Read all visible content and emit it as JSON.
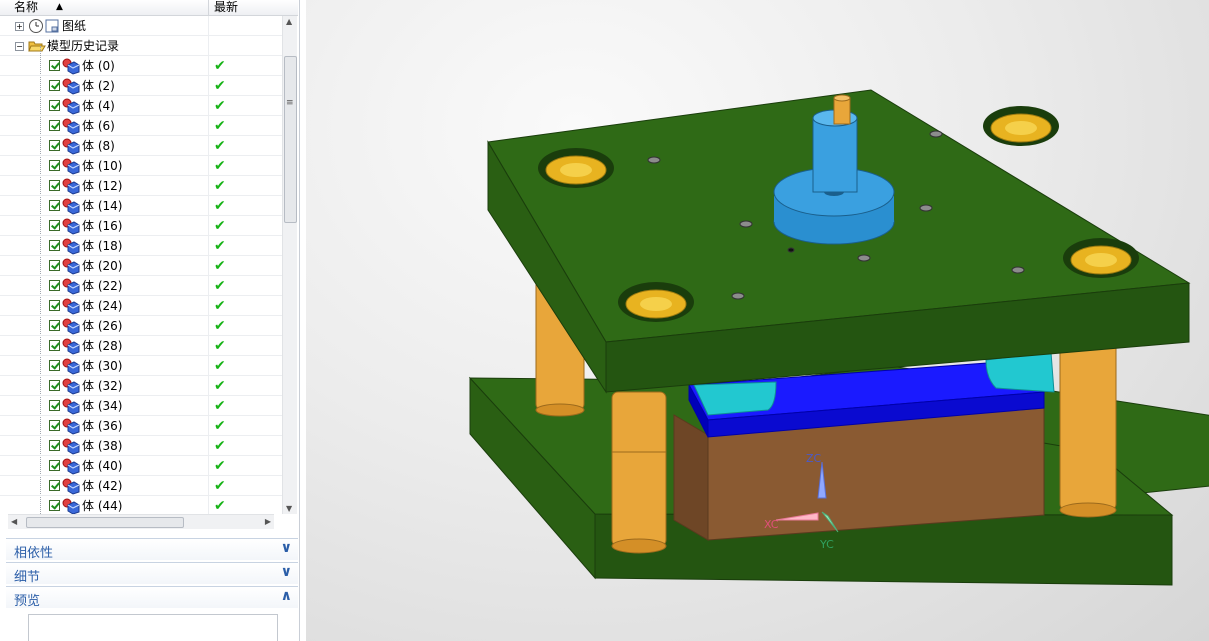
{
  "navigator": {
    "columns": {
      "name": "名称",
      "latest": "最新"
    },
    "tree": {
      "drawings": {
        "label": "图纸",
        "icon": "drawing-sheet-icon"
      },
      "model_history": {
        "label": "模型历史记录",
        "icon": "folder-open-icon"
      },
      "bodies": [
        {
          "label": "体 (0)"
        },
        {
          "label": "体 (2)"
        },
        {
          "label": "体 (4)"
        },
        {
          "label": "体 (6)"
        },
        {
          "label": "体 (8)"
        },
        {
          "label": "体 (10)"
        },
        {
          "label": "体 (12)"
        },
        {
          "label": "体 (14)"
        },
        {
          "label": "体 (16)"
        },
        {
          "label": "体 (18)"
        },
        {
          "label": "体 (20)"
        },
        {
          "label": "体 (22)"
        },
        {
          "label": "体 (24)"
        },
        {
          "label": "体 (26)"
        },
        {
          "label": "体 (28)"
        },
        {
          "label": "体 (30)"
        },
        {
          "label": "体 (32)"
        },
        {
          "label": "体 (34)"
        },
        {
          "label": "体 (36)"
        },
        {
          "label": "体 (38)"
        },
        {
          "label": "体 (40)"
        },
        {
          "label": "体 (42)"
        },
        {
          "label": "体 (44)"
        }
      ]
    },
    "sections": {
      "dependencies": "相依性",
      "details": "细节",
      "preview": "预览"
    }
  },
  "viewport": {
    "axes": {
      "z": "ZC",
      "x": "XC",
      "y": "YC"
    },
    "colors": {
      "plate": "#2f6a16",
      "pillar": "#e8a63a",
      "bushing_ring": "#e8b320",
      "sprue": "#3aa0e0",
      "cavity_blue": "#1a1aff",
      "insert_cyan": "#22c8d0",
      "block_brown": "#8a5a32"
    }
  }
}
